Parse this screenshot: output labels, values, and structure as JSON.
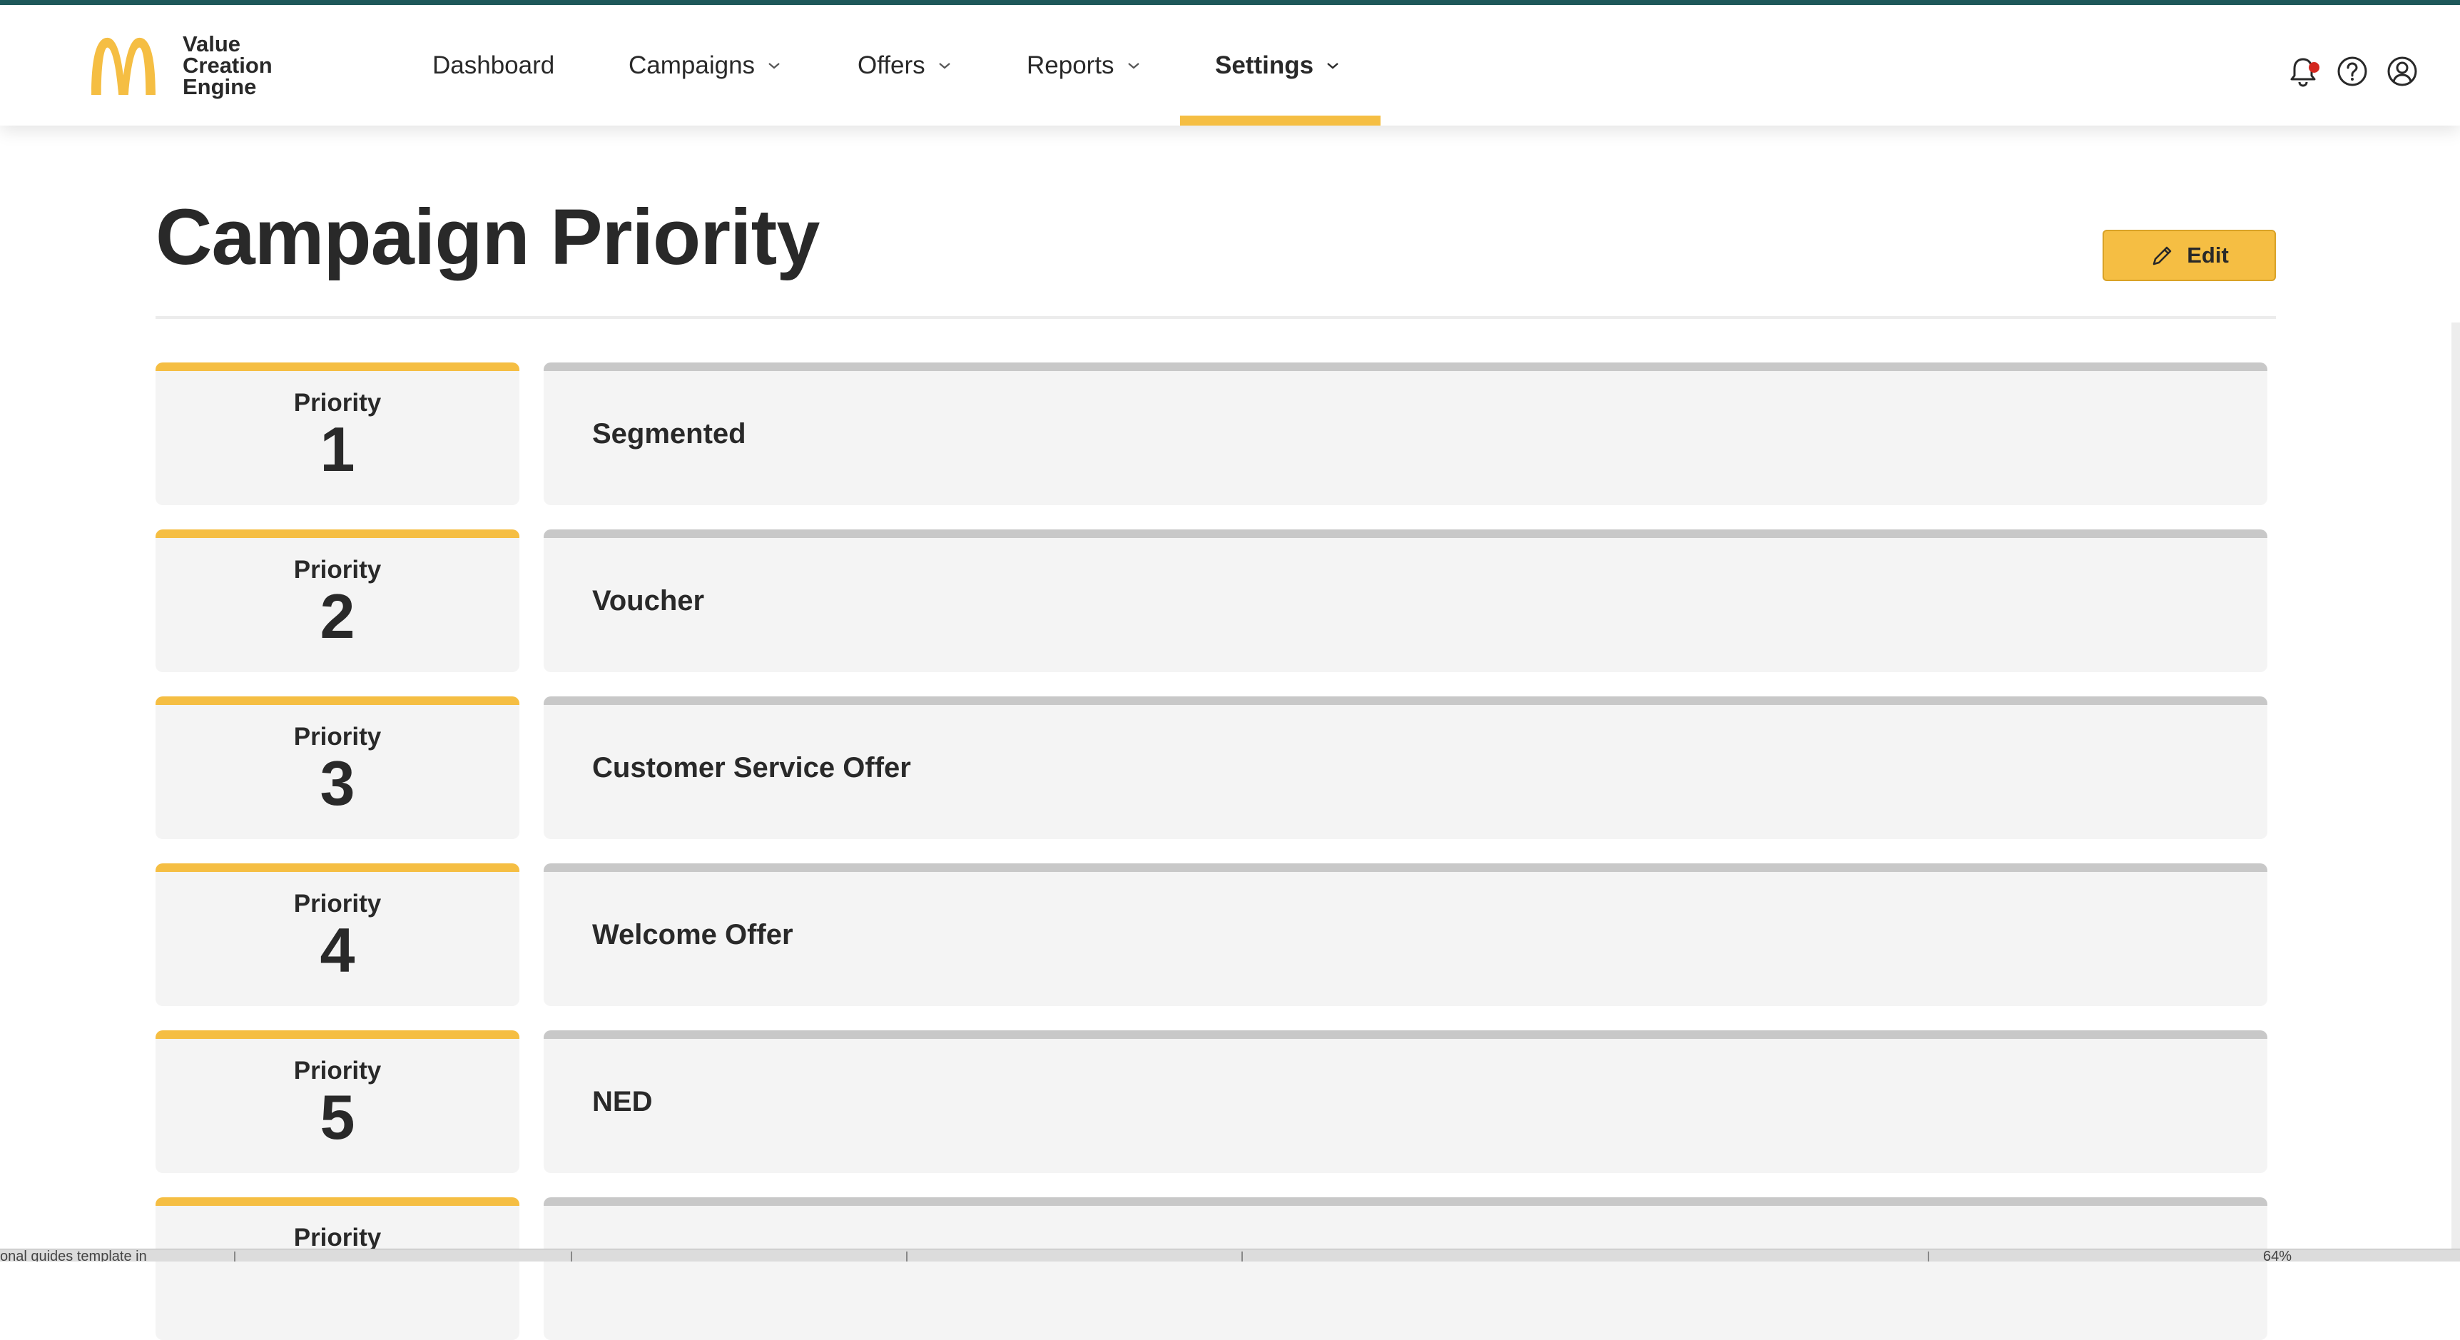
{
  "brand": {
    "lines": [
      "Value",
      "Creation",
      "Engine"
    ],
    "accent_color": "#f5be43"
  },
  "nav": {
    "items": [
      {
        "label": "Dashboard",
        "has_dropdown": false,
        "active": false
      },
      {
        "label": "Campaigns",
        "has_dropdown": true,
        "active": false
      },
      {
        "label": "Offers",
        "has_dropdown": true,
        "active": false
      },
      {
        "label": "Reports",
        "has_dropdown": true,
        "active": false
      },
      {
        "label": "Settings",
        "has_dropdown": true,
        "active": true
      }
    ],
    "icons": [
      "bell-icon",
      "help-icon",
      "user-icon"
    ],
    "has_notification": true
  },
  "page": {
    "title": "Campaign Priority",
    "edit_label": "Edit"
  },
  "priorities": [
    {
      "label": "Priority",
      "number": "1",
      "name": "Segmented"
    },
    {
      "label": "Priority",
      "number": "2",
      "name": "Voucher"
    },
    {
      "label": "Priority",
      "number": "3",
      "name": "Customer Service Offer"
    },
    {
      "label": "Priority",
      "number": "4",
      "name": "Welcome Offer"
    },
    {
      "label": "Priority",
      "number": "5",
      "name": "NED"
    },
    {
      "label": "Priority",
      "number": "",
      "name": ""
    }
  ],
  "taskbar": {
    "left_text": "onal guides template in",
    "zoom": "64%"
  }
}
